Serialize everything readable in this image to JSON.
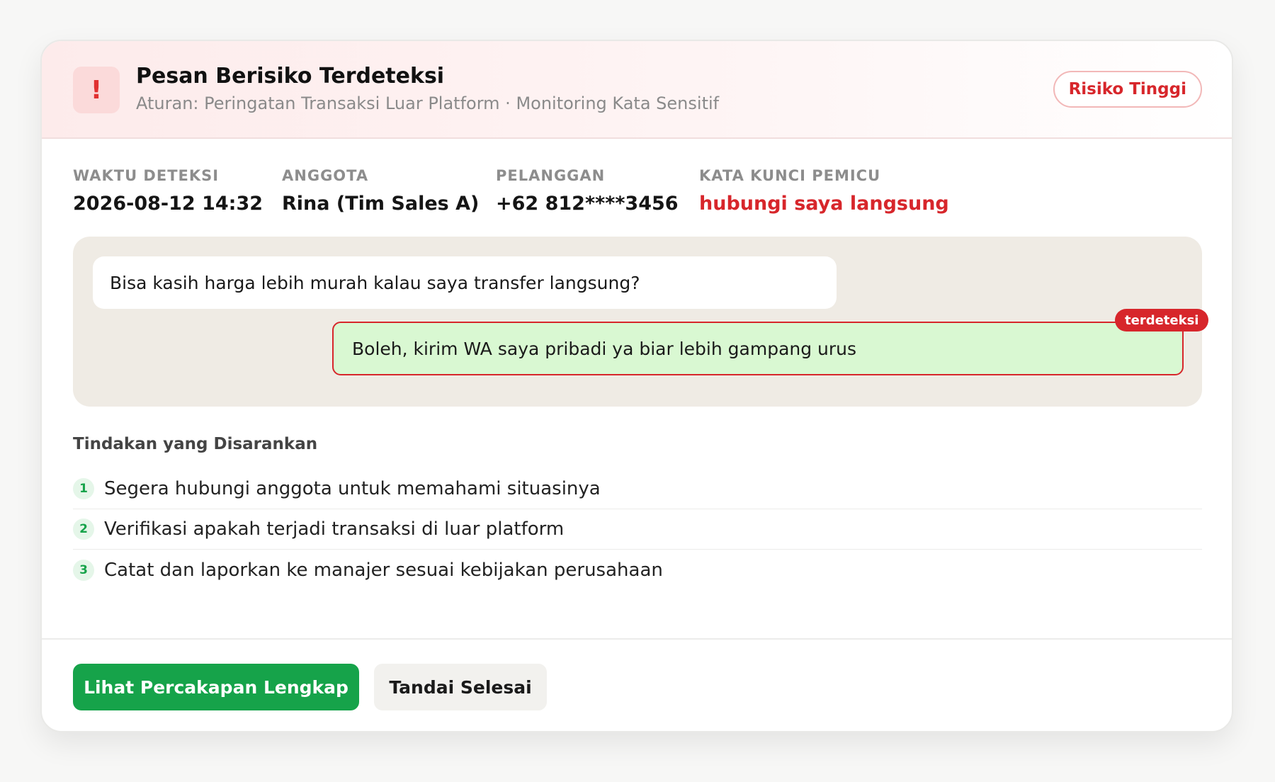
{
  "alert": {
    "icon": "exclamation-icon",
    "icon_glyph": "!",
    "title": "Pesan Berisiko Terdeteksi",
    "subtitle": "Aturan: Peringatan Transaksi Luar Platform · Monitoring Kata Sensitif",
    "risk_badge": "Risiko Tinggi"
  },
  "meta": {
    "time_label": "WAKTU DETEKSI",
    "time_value": "2026-08-12 14:32",
    "member_label": "ANGGOTA",
    "member_value": "Rina (Tim Sales A)",
    "customer_label": "PELANGGAN",
    "customer_value": "+62 812****3456",
    "keyword_label": "KATA KUNCI PEMICU",
    "keyword_value": "hubungi saya langsung"
  },
  "chat": {
    "incoming": "Bisa kasih harga lebih murah kalau saya transfer langsung?",
    "outgoing": "Boleh, kirim WA saya pribadi ya biar lebih gampang urus",
    "flag": "terdeteksi"
  },
  "actions": {
    "title": "Tindakan yang Disarankan",
    "items": [
      {
        "number": "1",
        "text": "Segera hubungi anggota untuk memahami situasinya"
      },
      {
        "number": "2",
        "text": "Verifikasi apakah terjadi transaksi di luar platform"
      },
      {
        "number": "3",
        "text": "Catat dan laporkan ke manajer sesuai kebijakan perusahaan"
      }
    ]
  },
  "buttons": {
    "primary": "Lihat Percakapan Lengkap",
    "secondary": "Tandai Selesai"
  },
  "colors": {
    "danger": "#d7262b",
    "success": "#16a34a",
    "chat_bg": "#efebe4",
    "outgoing_bubble": "#d9f8d2"
  }
}
